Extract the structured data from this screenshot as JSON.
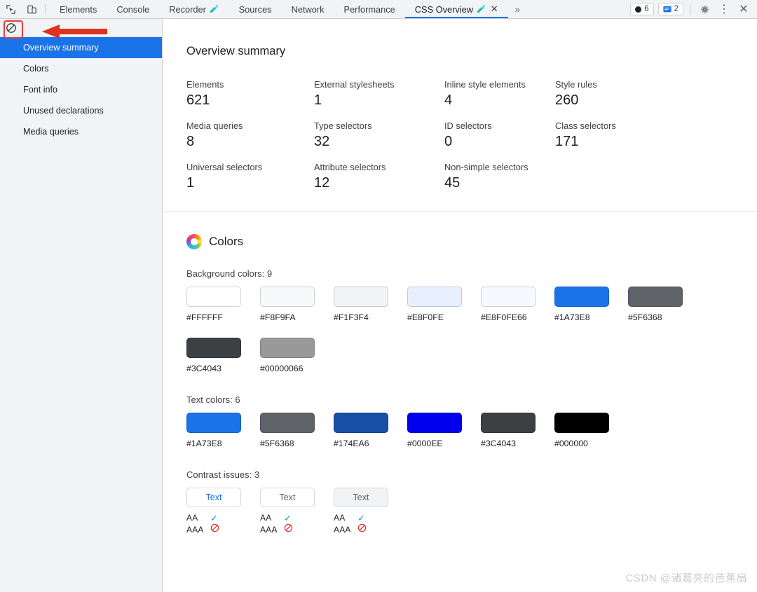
{
  "toolbar": {
    "inspect_icon": "inspect-cursor-icon",
    "device_icon": "device-toolbar-icon",
    "tabs": [
      {
        "label": "Elements",
        "active": false,
        "experimental": false,
        "closable": false
      },
      {
        "label": "Console",
        "active": false,
        "experimental": false,
        "closable": false
      },
      {
        "label": "Recorder",
        "active": false,
        "experimental": true,
        "closable": false
      },
      {
        "label": "Sources",
        "active": false,
        "experimental": false,
        "closable": false
      },
      {
        "label": "Network",
        "active": false,
        "experimental": false,
        "closable": false
      },
      {
        "label": "Performance",
        "active": false,
        "experimental": false,
        "closable": false
      },
      {
        "label": "CSS Overview",
        "active": true,
        "experimental": true,
        "closable": true
      }
    ],
    "more_tabs_label": "»",
    "errors_count": "6",
    "messages_count": "2",
    "settings_label": "⚙",
    "more_label": "⋮",
    "close_label": "✕",
    "accent_color": "#1a73e8"
  },
  "sidebar": {
    "clear_icon": "clear-overview-icon",
    "items": [
      {
        "label": "Overview summary",
        "selected": true
      },
      {
        "label": "Colors",
        "selected": false
      },
      {
        "label": "Font info",
        "selected": false
      },
      {
        "label": "Unused declarations",
        "selected": false
      },
      {
        "label": "Media queries",
        "selected": false
      }
    ],
    "selected_bg": "#1a73e8",
    "background": "#f1f3f4"
  },
  "summary": {
    "title": "Overview summary",
    "stats": [
      {
        "label": "Elements",
        "value": "621"
      },
      {
        "label": "External stylesheets",
        "value": "1"
      },
      {
        "label": "Inline style elements",
        "value": "4"
      },
      {
        "label": "Style rules",
        "value": "260"
      },
      {
        "label": "Media queries",
        "value": "8"
      },
      {
        "label": "Type selectors",
        "value": "32"
      },
      {
        "label": "ID selectors",
        "value": "0"
      },
      {
        "label": "Class selectors",
        "value": "171"
      },
      {
        "label": "Universal selectors",
        "value": "1"
      },
      {
        "label": "Attribute selectors",
        "value": "12"
      },
      {
        "label": "Non-simple selectors",
        "value": "45"
      },
      {
        "label": "",
        "value": ""
      }
    ]
  },
  "colors": {
    "title": "Colors",
    "icon": "color-wheel-icon",
    "background_group_label": "Background colors: 9",
    "background_colors": [
      {
        "hex": "#FFFFFF",
        "css": "#FFFFFF"
      },
      {
        "hex": "#F8F9FA",
        "css": "#F8F9FA"
      },
      {
        "hex": "#F1F3F4",
        "css": "#F1F3F4"
      },
      {
        "hex": "#E8F0FE",
        "css": "#E8F0FE"
      },
      {
        "hex": "#E8F0FE66",
        "css": "#E8F0FE66"
      },
      {
        "hex": "#1A73E8",
        "css": "#1A73E8"
      },
      {
        "hex": "#5F6368",
        "css": "#5F6368"
      },
      {
        "hex": "#3C4043",
        "css": "#3C4043"
      },
      {
        "hex": "#00000066",
        "css": "#00000066"
      }
    ],
    "text_group_label": "Text colors: 6",
    "text_colors": [
      {
        "hex": "#1A73E8",
        "css": "#1A73E8"
      },
      {
        "hex": "#5F6368",
        "css": "#5F6368"
      },
      {
        "hex": "#174EA6",
        "css": "#174EA6"
      },
      {
        "hex": "#0000EE",
        "css": "#0000EE"
      },
      {
        "hex": "#3C4043",
        "css": "#3C4043"
      },
      {
        "hex": "#000000",
        "css": "#000000"
      }
    ],
    "contrast_group_label": "Contrast issues: 3",
    "contrast_items": [
      {
        "sample_text": "Text",
        "text_color": "#1A73E8",
        "bg_color": "#FFFFFF",
        "aa_label": "AA",
        "aa_pass": true,
        "aaa_label": "AAA",
        "aaa_pass": false
      },
      {
        "sample_text": "Text",
        "text_color": "#5F6368",
        "bg_color": "#FFFFFF",
        "aa_label": "AA",
        "aa_pass": true,
        "aaa_label": "AAA",
        "aaa_pass": false
      },
      {
        "sample_text": "Text",
        "text_color": "#5F6368",
        "bg_color": "#F1F3F4",
        "aa_label": "AA",
        "aa_pass": true,
        "aaa_label": "AAA",
        "aaa_pass": false
      }
    ]
  },
  "annotation": {
    "highlight_color": "#e83c3c",
    "arrow_direction": "left"
  },
  "watermark": {
    "text": "CSDN @诸葛亮的芭蕉扇"
  }
}
